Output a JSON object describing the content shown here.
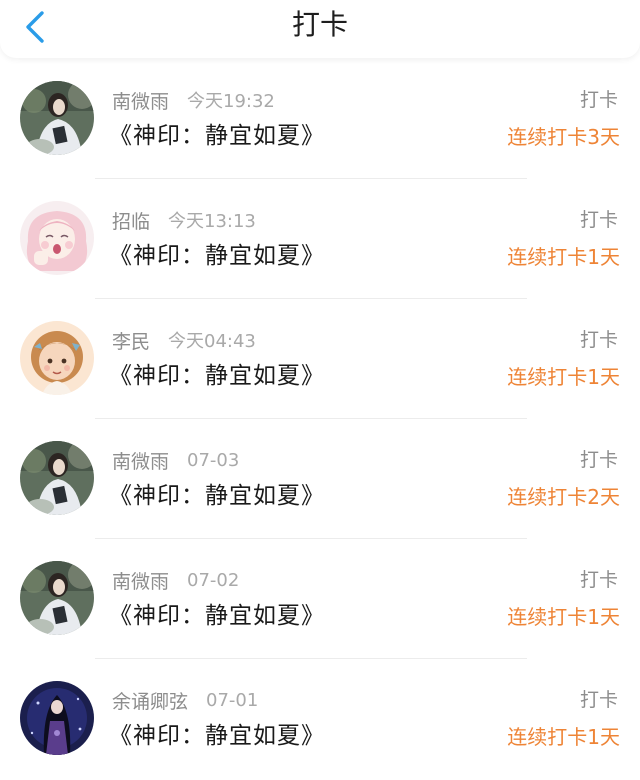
{
  "header": {
    "title": "打卡",
    "back_icon": "chevron-left-icon",
    "accent_color": "#2a9ce8"
  },
  "entries": [
    {
      "user": "南微雨",
      "time": "今天19:32",
      "book": "《神印：静宜如夏》",
      "action": "打卡",
      "streak": "连续打卡3天",
      "avatar": "photo-avatar"
    },
    {
      "user": "招临",
      "time": "今天13:13",
      "book": "《神印：静宜如夏》",
      "action": "打卡",
      "streak": "连续打卡1天",
      "avatar": "illustrated-avatar"
    },
    {
      "user": "李民",
      "time": "今天04:43",
      "book": "《神印：静宜如夏》",
      "action": "打卡",
      "streak": "连续打卡1天",
      "avatar": "doll-avatar"
    },
    {
      "user": "南微雨",
      "time": "07-03",
      "book": "《神印：静宜如夏》",
      "action": "打卡",
      "streak": "连续打卡2天",
      "avatar": "photo-avatar"
    },
    {
      "user": "南微雨",
      "time": "07-02",
      "book": "《神印：静宜如夏》",
      "action": "打卡",
      "streak": "连续打卡1天",
      "avatar": "photo-avatar"
    },
    {
      "user": "余诵卿弦",
      "time": "07-01",
      "book": "《神印：静宜如夏》",
      "action": "打卡",
      "streak": "连续打卡1天",
      "avatar": "night-avatar"
    }
  ],
  "colors": {
    "streak": "#ee8436",
    "username": "#8d8d8d",
    "timestamp": "#a9a9a9"
  }
}
